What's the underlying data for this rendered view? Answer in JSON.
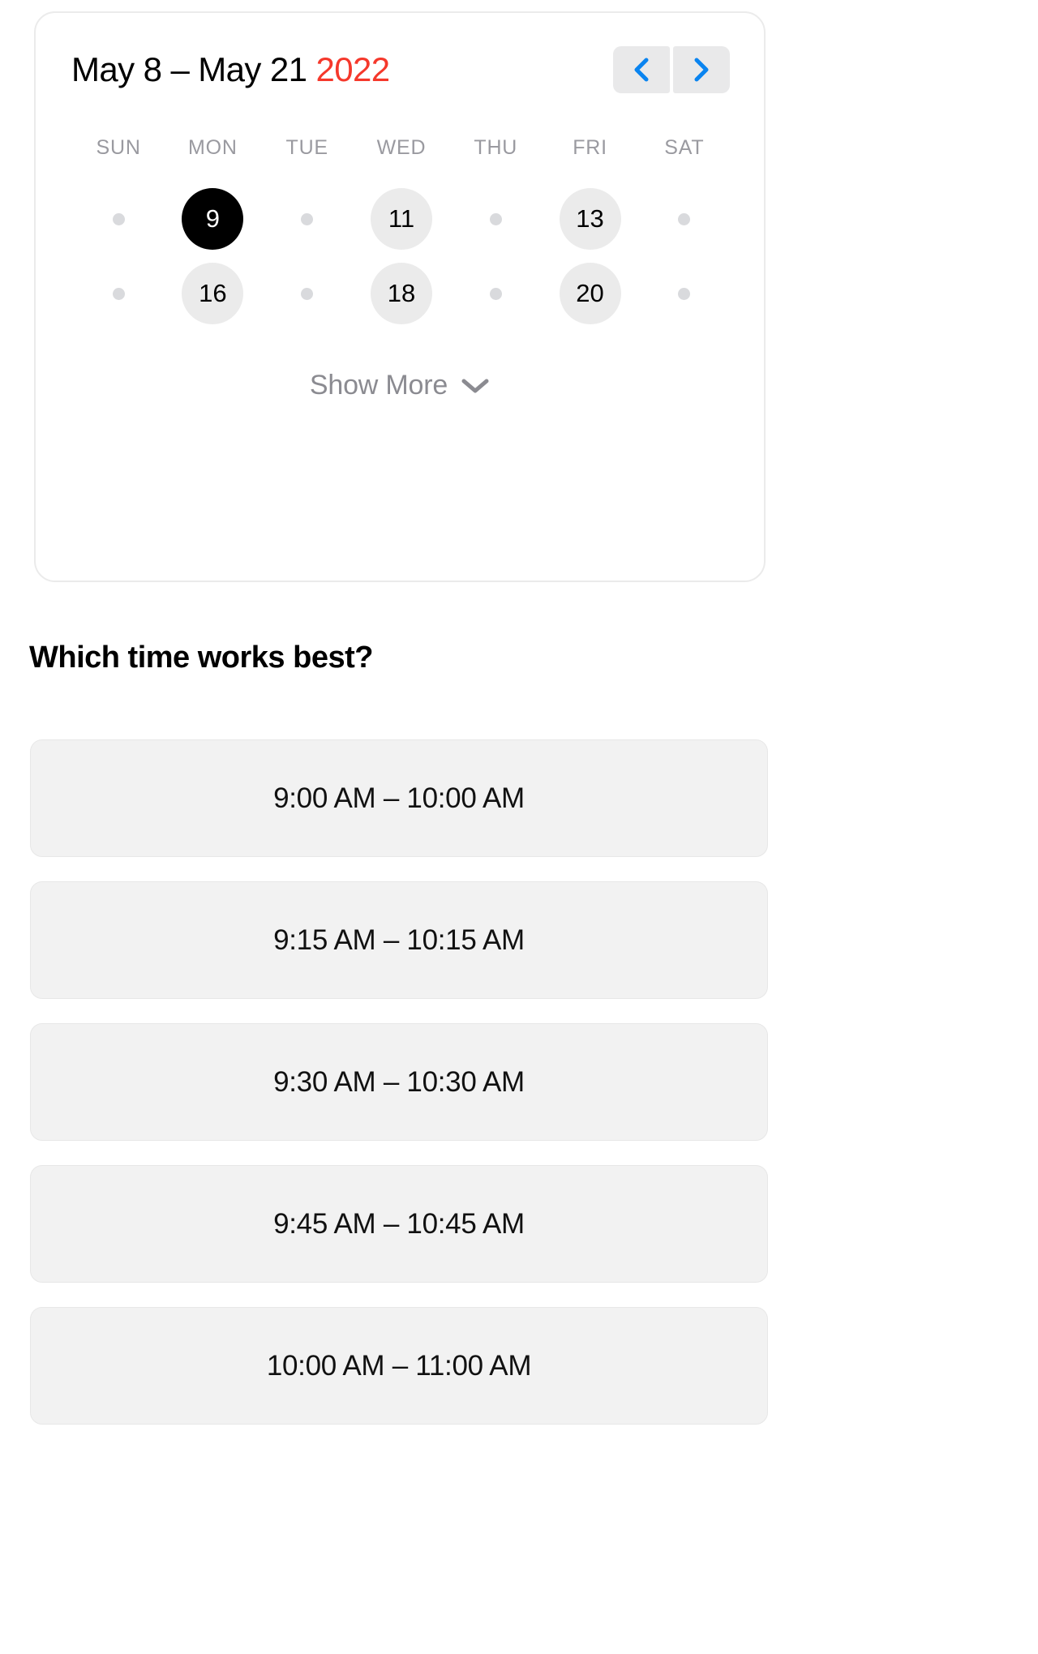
{
  "calendar": {
    "title_range": "May 8 – May 21",
    "year": "2022",
    "nav": {
      "prev_icon": "chevron-left-icon",
      "next_icon": "chevron-right-icon",
      "accent_color": "#0a84f0",
      "button_bg": "#e9e9ea"
    },
    "weekdays": [
      "SUN",
      "MON",
      "TUE",
      "WED",
      "THU",
      "FRI",
      "SAT"
    ],
    "weeks": [
      [
        {
          "type": "dot",
          "label": ""
        },
        {
          "type": "date",
          "label": "9",
          "state": "selected"
        },
        {
          "type": "dot",
          "label": ""
        },
        {
          "type": "date",
          "label": "11",
          "state": "available"
        },
        {
          "type": "dot",
          "label": ""
        },
        {
          "type": "date",
          "label": "13",
          "state": "available"
        },
        {
          "type": "dot",
          "label": ""
        }
      ],
      [
        {
          "type": "dot",
          "label": ""
        },
        {
          "type": "date",
          "label": "16",
          "state": "available"
        },
        {
          "type": "dot",
          "label": ""
        },
        {
          "type": "date",
          "label": "18",
          "state": "available"
        },
        {
          "type": "dot",
          "label": ""
        },
        {
          "type": "date",
          "label": "20",
          "state": "available"
        },
        {
          "type": "dot",
          "label": ""
        }
      ]
    ],
    "show_more": {
      "label": "Show More",
      "icon": "chevron-down-icon"
    },
    "colors": {
      "selected_bg": "#000000",
      "available_bg": "#ebebeb",
      "dot": "#d9dadd",
      "year_accent": "#f5382b",
      "weekday_text": "#9a9aa0"
    }
  },
  "section": {
    "heading": "Which time works best?"
  },
  "time_slots": [
    {
      "label": "9:00 AM – 10:00 AM"
    },
    {
      "label": "9:15 AM – 10:15 AM"
    },
    {
      "label": "9:30 AM – 10:30 AM"
    },
    {
      "label": "9:45 AM – 10:45 AM"
    },
    {
      "label": "10:00 AM – 11:00 AM"
    }
  ]
}
